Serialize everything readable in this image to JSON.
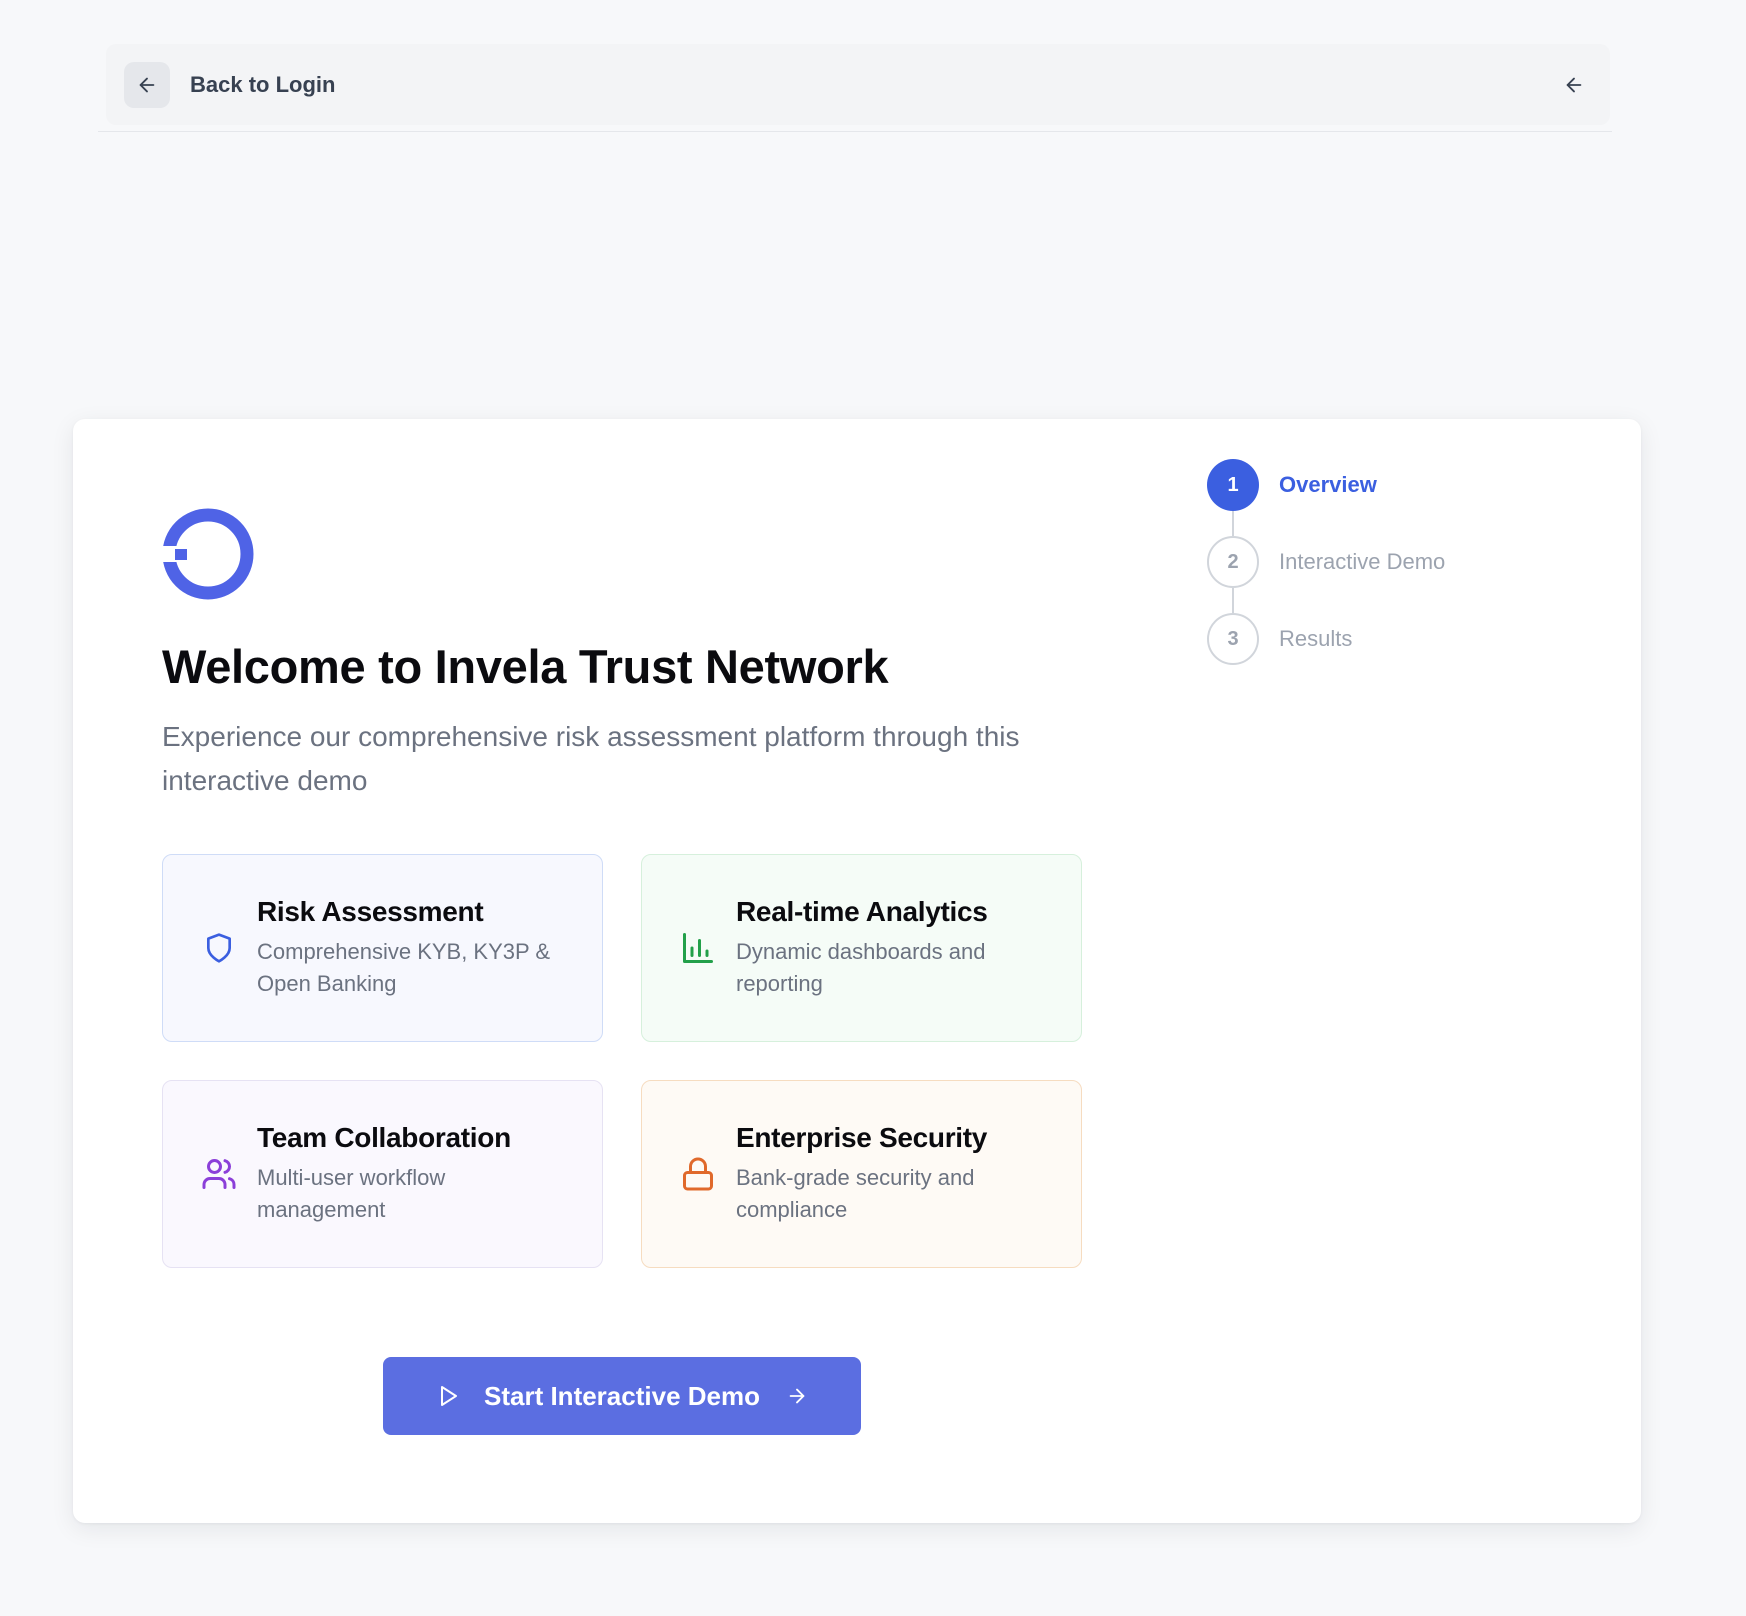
{
  "topbar": {
    "back_label": "Back to Login",
    "back_icon": "arrow-left-icon",
    "right_icon": "arrow-left-icon"
  },
  "main": {
    "logo_icon": "invela-logo",
    "title": "Welcome to Invela Trust Network",
    "subtitle": "Experience our comprehensive risk assessment platform through this interactive demo",
    "features": [
      {
        "icon": "shield-icon",
        "title": "Risk Assessment",
        "description": "Comprehensive KYB, KY3P & Open Banking",
        "accent": "#3b5fe0"
      },
      {
        "icon": "bar-chart-icon",
        "title": "Real-time Analytics",
        "description": "Dynamic dashboards and reporting",
        "accent": "#22a04a"
      },
      {
        "icon": "users-icon",
        "title": "Team Collaboration",
        "description": "Multi-user workflow management",
        "accent": "#8b3fd9"
      },
      {
        "icon": "lock-icon",
        "title": "Enterprise Security",
        "description": "Bank-grade security and compliance",
        "accent": "#e0692b"
      }
    ],
    "cta_label": "Start Interactive Demo"
  },
  "steps": [
    {
      "number": "1",
      "label": "Overview",
      "state": "active"
    },
    {
      "number": "2",
      "label": "Interactive Demo",
      "state": "inactive"
    },
    {
      "number": "3",
      "label": "Results",
      "state": "inactive"
    }
  ],
  "colors": {
    "primary": "#3b5fe0",
    "cta": "#5b6ee1",
    "logo": "#4f63e6"
  }
}
